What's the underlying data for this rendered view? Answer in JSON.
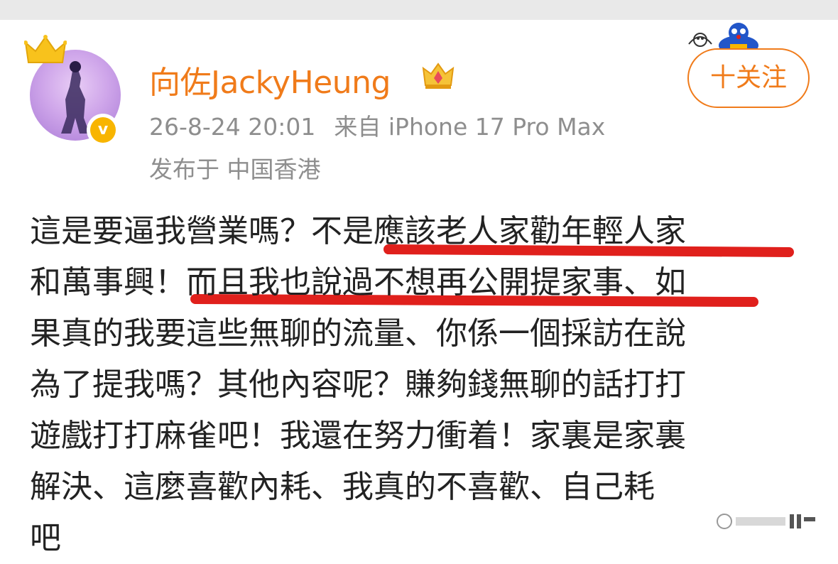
{
  "post": {
    "author": {
      "name": "向佐JackyHeung",
      "avatar_icon": "avatar-photo",
      "crown_icon": "crown-icon",
      "verified_icon": "verified-badge-icon",
      "vip_icon": "vip-crown-badge-icon"
    },
    "timestamp": "26-8-24 20:01",
    "source": "来自 iPhone 17 Pro Max",
    "location": "发布于 中国香港",
    "follow_label": "十关注",
    "content_lines": [
      "這是要逼我營業嗎？不是應該老人家勸年輕人家",
      "和萬事興！而且我也說過不想再公開提家事、如",
      "果真的我要這些無聊的流量、你係一個採訪在說",
      "為了提我嗎？其他內容呢？賺夠錢無聊的話打打",
      "遊戲打打麻雀吧！我還在努力衝着！家裏是家裏",
      "解決、這麼喜歡內耗、我真的不喜歡、自己耗",
      "吧"
    ]
  },
  "colors": {
    "accent": "#f07b1a",
    "meta_text": "#8e8e8e",
    "body_text": "#222222",
    "highlight_underline": "#e0201c",
    "verified": "#f8b500"
  }
}
